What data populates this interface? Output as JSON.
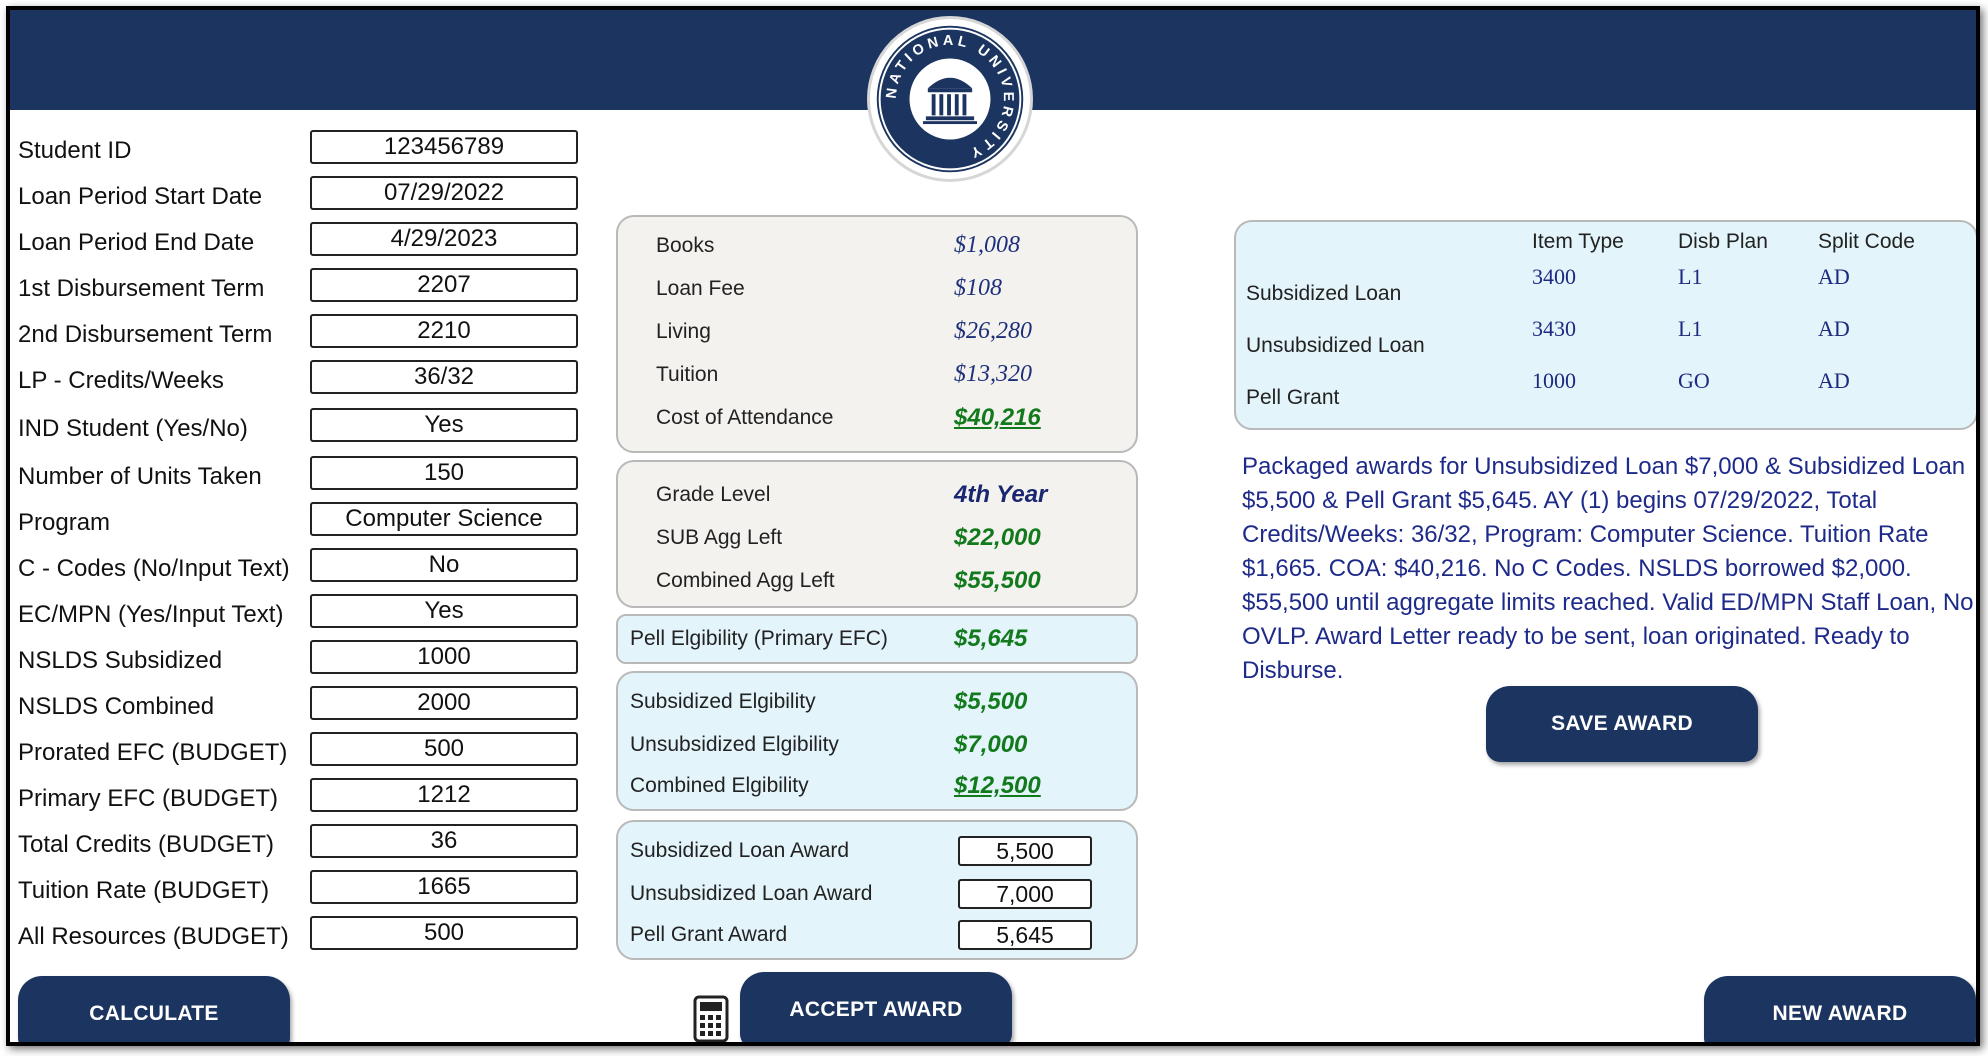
{
  "form": {
    "fields": [
      {
        "label": "Student ID",
        "value": "123456789"
      },
      {
        "label": "Loan Period Start Date",
        "value": "07/29/2022"
      },
      {
        "label": "Loan Period End Date",
        "value": "4/29/2023"
      },
      {
        "label": "1st Disbursement Term",
        "value": "2207"
      },
      {
        "label": "2nd Disbursement Term",
        "value": "2210"
      },
      {
        "label": "LP - Credits/Weeks",
        "value": "36/32"
      },
      {
        "label": "IND Student (Yes/No)",
        "value": "Yes"
      },
      {
        "label": "Number of Units Taken",
        "value": "150"
      },
      {
        "label": "Program",
        "value": "Computer Science"
      },
      {
        "label": "C - Codes (No/Input Text)",
        "value": "No"
      },
      {
        "label": "EC/MPN (Yes/Input Text)",
        "value": "Yes"
      },
      {
        "label": "NSLDS Subsidized",
        "value": "1000"
      },
      {
        "label": "NSLDS Combined",
        "value": "2000"
      },
      {
        "label": "Prorated EFC (BUDGET)",
        "value": "500"
      },
      {
        "label": "Primary EFC (BUDGET)",
        "value": "1212"
      },
      {
        "label": "Total Credits (BUDGET)",
        "value": "36"
      },
      {
        "label": "Tuition Rate (BUDGET)",
        "value": "1665"
      },
      {
        "label": "All Resources (BUDGET)",
        "value": "500"
      }
    ]
  },
  "coa": {
    "rows": [
      {
        "label": "Books",
        "value": "$1,008"
      },
      {
        "label": "Loan Fee",
        "value": "$108"
      },
      {
        "label": "Living",
        "value": "$26,280"
      },
      {
        "label": "Tuition",
        "value": "$13,320"
      },
      {
        "label": "Cost of Attendance",
        "value": "$40,216"
      }
    ]
  },
  "grade": {
    "rows": [
      {
        "label": "Grade Level",
        "value": "4th Year"
      },
      {
        "label": "SUB Agg Left",
        "value": "$22,000"
      },
      {
        "label": "Combined Agg Left",
        "value": "$55,500"
      }
    ]
  },
  "pell": {
    "label": "Pell Elgibility (Primary EFC)",
    "value": "$5,645"
  },
  "eligibility": {
    "rows": [
      {
        "label": "Subsidized Elgibility",
        "value": "$5,500"
      },
      {
        "label": "Unsubsidized Elgibility",
        "value": "$7,000"
      },
      {
        "label": "Combined Elgibility",
        "value": "$12,500"
      }
    ]
  },
  "awards": {
    "rows": [
      {
        "label": "Subsidized Loan Award",
        "value": "5,500"
      },
      {
        "label": "Unsubsidized Loan Award",
        "value": "7,000"
      },
      {
        "label": "Pell Grant Award",
        "value": "5,645"
      }
    ]
  },
  "codes_table": {
    "headers": [
      "Item Type",
      "Disb Plan",
      "Split Code"
    ],
    "rows": [
      {
        "label": "Subsidized Loan",
        "item_type": "3400",
        "disb_plan": "L1",
        "split_code": "AD"
      },
      {
        "label": "Unsubsidized Loan",
        "item_type": "3430",
        "disb_plan": "L1",
        "split_code": "AD"
      },
      {
        "label": "Pell Grant",
        "item_type": "1000",
        "disb_plan": "GO",
        "split_code": "AD"
      }
    ]
  },
  "summary": "Packaged awards for Unsubsidized Loan $7,000 & Subsidized Loan $5,500 & Pell Grant $5,645. AY (1) begins 07/29/2022, Total Credits/Weeks: 36/32, Program: Computer Science. Tuition Rate $1,665. COA: $40,216. No C Codes. NSLDS borrowed $2,000. $55,500 until aggregate limits reached. Valid ED/MPN Staff Loan, No OVLP. Award Letter ready to be sent, loan originated. Ready to Disburse.",
  "logo": {
    "arc_text": "NATIONAL UNIVERSITY"
  },
  "buttons": {
    "calculate": "CALCULATE",
    "accept": "ACCEPT AWARD",
    "save": "SAVE AWARD",
    "new": "NEW AWARD"
  },
  "colors": {
    "navy": "#1c3560",
    "panel_gray": "#f3f2ee",
    "panel_blue": "#e3f4fb",
    "value_green": "#127a1c",
    "value_blue": "#1d2f7a"
  }
}
